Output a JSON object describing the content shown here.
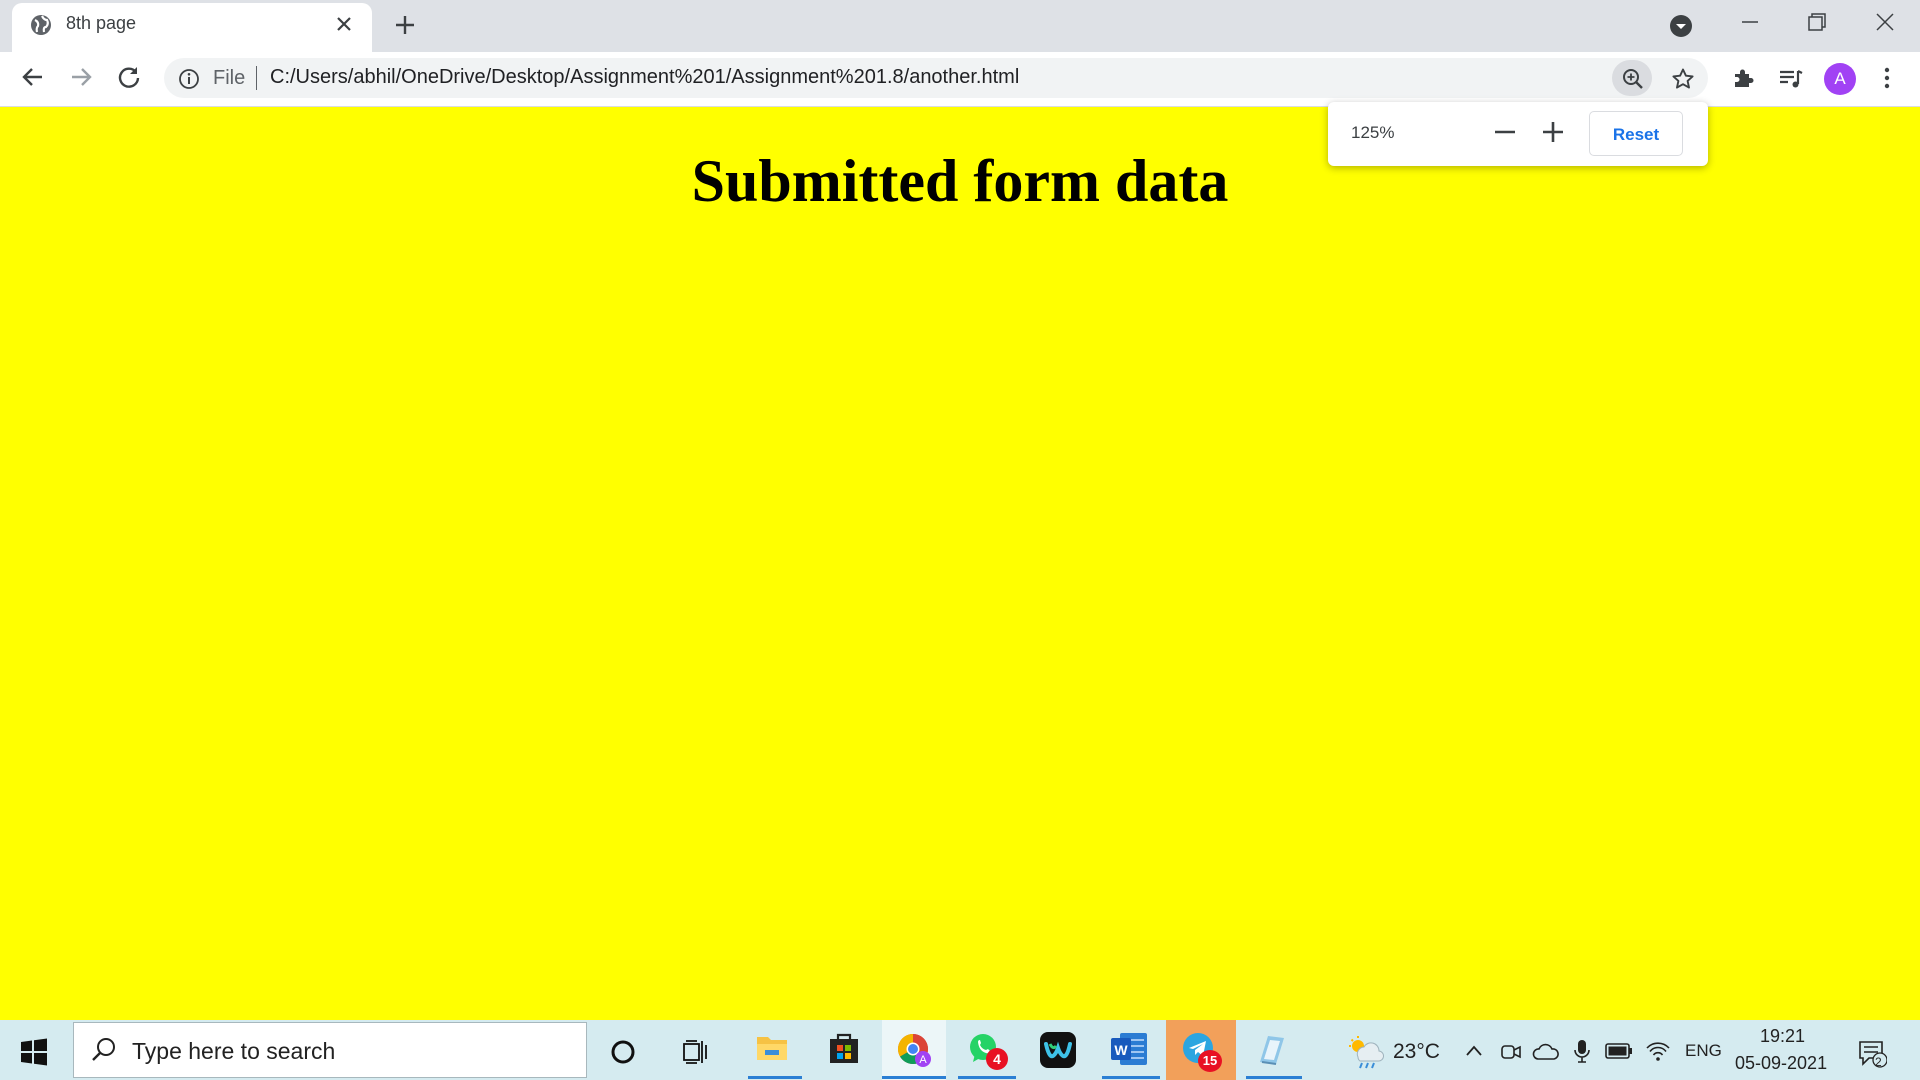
{
  "browser": {
    "tab_title": "8th page",
    "scheme_label": "File",
    "url": "C:/Users/abhil/OneDrive/Desktop/Assignment%201/Assignment%201.8/another.html",
    "profile_initial": "A"
  },
  "zoom_popup": {
    "value": "125%",
    "reset_label": "Reset"
  },
  "page": {
    "heading": "Submitted form data",
    "background": "#ffff00"
  },
  "taskbar": {
    "search_placeholder": "Type here to search",
    "apps": [
      "file-explorer",
      "microsoft-store",
      "chrome",
      "whatsapp",
      "webex",
      "word",
      "telegram",
      "notepad"
    ],
    "whatsapp_badge": "4",
    "telegram_badge": "15",
    "weather_temp": "23°C",
    "language": "ENG",
    "time": "19:21",
    "date": "05-09-2021",
    "notification_count": "2"
  },
  "colors": {
    "accent": "#1a73e8",
    "avatar": "#a142f4",
    "taskbar": "#d5ebf0"
  }
}
